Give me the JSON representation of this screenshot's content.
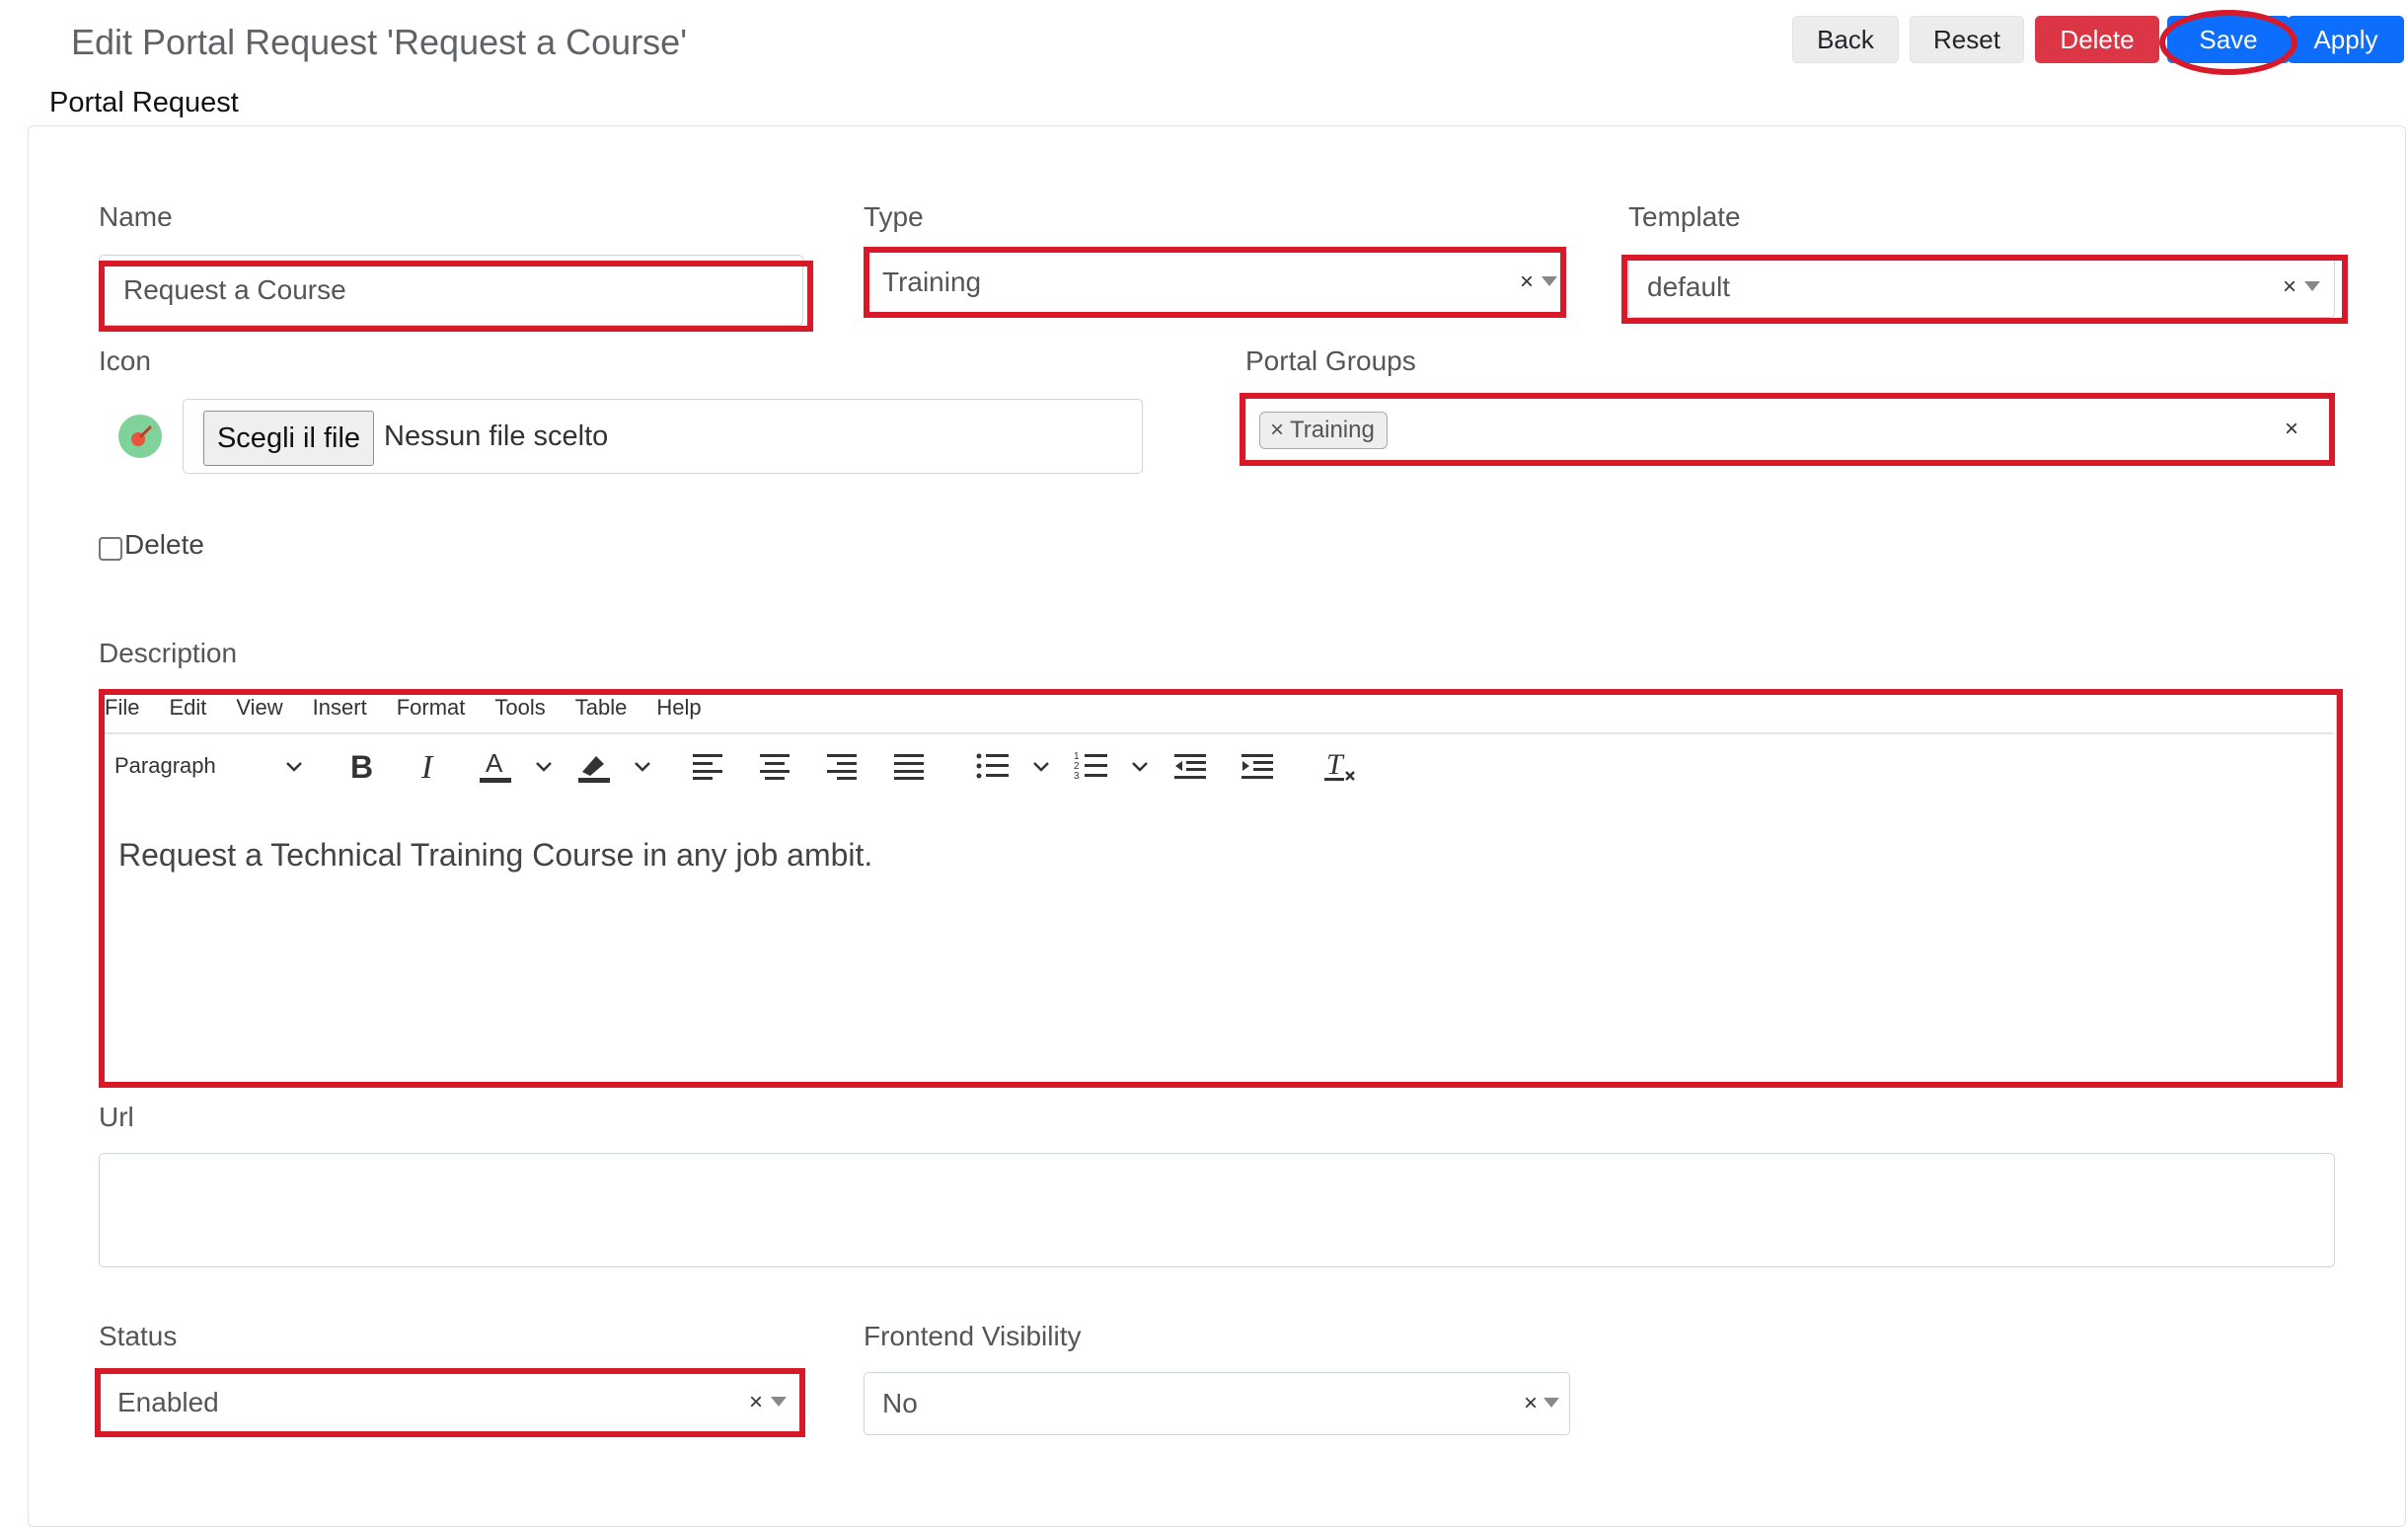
{
  "header": {
    "page_title": "Edit Portal Request 'Request a Course'",
    "section_title": "Portal Request",
    "buttons": {
      "back": "Back",
      "reset": "Reset",
      "delete": "Delete",
      "save": "Save",
      "apply": "Apply"
    }
  },
  "form": {
    "name": {
      "label": "Name",
      "value": "Request a Course"
    },
    "type": {
      "label": "Type",
      "value": "Training"
    },
    "template": {
      "label": "Template",
      "value": "default"
    },
    "icon": {
      "label": "Icon",
      "file_button": "Scegli il file",
      "file_status": "Nessun file scelto",
      "delete_label": "Delete"
    },
    "portal_groups": {
      "label": "Portal Groups",
      "tags": [
        "Training"
      ]
    },
    "description": {
      "label": "Description",
      "menu": [
        "File",
        "Edit",
        "View",
        "Insert",
        "Format",
        "Tools",
        "Table",
        "Help"
      ],
      "block_format": "Paragraph",
      "text": "Request a Technical Training Course in any job ambit."
    },
    "url": {
      "label": "Url",
      "value": ""
    },
    "status": {
      "label": "Status",
      "value": "Enabled"
    },
    "frontend_visibility": {
      "label": "Frontend Visibility",
      "value": "No"
    }
  },
  "icons": {
    "clear": "×",
    "tag_remove": "×"
  },
  "colors": {
    "highlight": "#d7192a",
    "primary": "#0d6efd",
    "danger": "#dc3545"
  }
}
